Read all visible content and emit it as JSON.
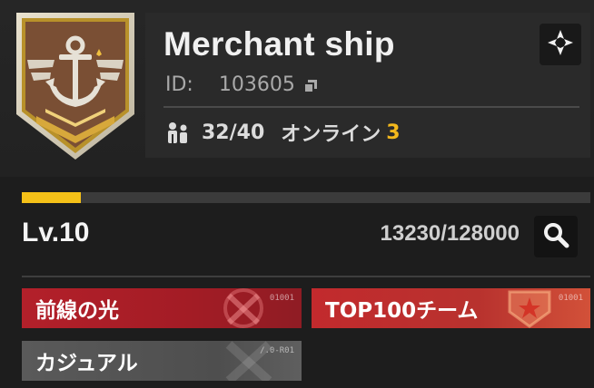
{
  "guild": {
    "name": "Merchant ship",
    "id_label": "ID:",
    "id_value": "103605",
    "members": "32/40",
    "online_label": "オンライン",
    "online_count": "3",
    "emblem_icon": "anchor-emblem-icon"
  },
  "level": {
    "label": "Lv.10",
    "exp": "13230/128000",
    "progress_fraction": 0.1034
  },
  "tags": [
    {
      "label": "前線の光",
      "code": "01001",
      "icon": "crossed-swords-icon"
    },
    {
      "label": "TOP100チーム",
      "code": "01001",
      "icon": "star-shield-icon"
    },
    {
      "label": "カジュアル",
      "code": "/.0-R01",
      "icon": "cross-icon"
    }
  ],
  "icons": {
    "settings": "settings-icon",
    "search": "search-icon",
    "copy": "copy-icon",
    "members": "members-icon"
  },
  "colors": {
    "accent_gold": "#f5c118",
    "tag_red": "#b3202a",
    "tag_gray": "#555555"
  }
}
